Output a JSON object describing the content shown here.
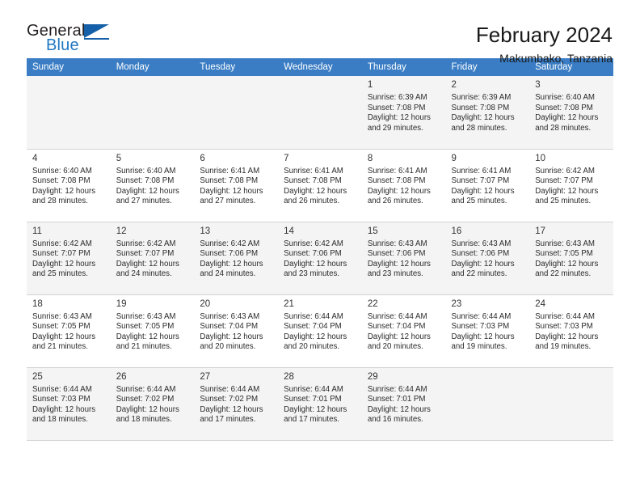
{
  "brand": {
    "name_top": "General",
    "name_bottom": "Blue",
    "flag_icon": "triangle-flag-icon",
    "color_dark": "#231f20",
    "color_blue": "#1f77c2"
  },
  "header": {
    "title": "February 2024",
    "subtitle": "Makumbako, Tanzania"
  },
  "theme": {
    "header_row_bg": "#3a7dc4",
    "header_row_text": "#ffffff",
    "alt_row_bg": "#f4f4f4",
    "grid_line": "#d3d3d3"
  },
  "weekday_headers": [
    "Sunday",
    "Monday",
    "Tuesday",
    "Wednesday",
    "Thursday",
    "Friday",
    "Saturday"
  ],
  "weeks": [
    [
      {
        "day": "",
        "info": "",
        "empty": true
      },
      {
        "day": "",
        "info": "",
        "empty": true
      },
      {
        "day": "",
        "info": "",
        "empty": true
      },
      {
        "day": "",
        "info": "",
        "empty": true
      },
      {
        "day": "1",
        "info": "Sunrise: 6:39 AM\nSunset: 7:08 PM\nDaylight: 12 hours\nand 29 minutes."
      },
      {
        "day": "2",
        "info": "Sunrise: 6:39 AM\nSunset: 7:08 PM\nDaylight: 12 hours\nand 28 minutes."
      },
      {
        "day": "3",
        "info": "Sunrise: 6:40 AM\nSunset: 7:08 PM\nDaylight: 12 hours\nand 28 minutes."
      }
    ],
    [
      {
        "day": "4",
        "info": "Sunrise: 6:40 AM\nSunset: 7:08 PM\nDaylight: 12 hours\nand 28 minutes."
      },
      {
        "day": "5",
        "info": "Sunrise: 6:40 AM\nSunset: 7:08 PM\nDaylight: 12 hours\nand 27 minutes."
      },
      {
        "day": "6",
        "info": "Sunrise: 6:41 AM\nSunset: 7:08 PM\nDaylight: 12 hours\nand 27 minutes."
      },
      {
        "day": "7",
        "info": "Sunrise: 6:41 AM\nSunset: 7:08 PM\nDaylight: 12 hours\nand 26 minutes."
      },
      {
        "day": "8",
        "info": "Sunrise: 6:41 AM\nSunset: 7:08 PM\nDaylight: 12 hours\nand 26 minutes."
      },
      {
        "day": "9",
        "info": "Sunrise: 6:41 AM\nSunset: 7:07 PM\nDaylight: 12 hours\nand 25 minutes."
      },
      {
        "day": "10",
        "info": "Sunrise: 6:42 AM\nSunset: 7:07 PM\nDaylight: 12 hours\nand 25 minutes."
      }
    ],
    [
      {
        "day": "11",
        "info": "Sunrise: 6:42 AM\nSunset: 7:07 PM\nDaylight: 12 hours\nand 25 minutes."
      },
      {
        "day": "12",
        "info": "Sunrise: 6:42 AM\nSunset: 7:07 PM\nDaylight: 12 hours\nand 24 minutes."
      },
      {
        "day": "13",
        "info": "Sunrise: 6:42 AM\nSunset: 7:06 PM\nDaylight: 12 hours\nand 24 minutes."
      },
      {
        "day": "14",
        "info": "Sunrise: 6:42 AM\nSunset: 7:06 PM\nDaylight: 12 hours\nand 23 minutes."
      },
      {
        "day": "15",
        "info": "Sunrise: 6:43 AM\nSunset: 7:06 PM\nDaylight: 12 hours\nand 23 minutes."
      },
      {
        "day": "16",
        "info": "Sunrise: 6:43 AM\nSunset: 7:06 PM\nDaylight: 12 hours\nand 22 minutes."
      },
      {
        "day": "17",
        "info": "Sunrise: 6:43 AM\nSunset: 7:05 PM\nDaylight: 12 hours\nand 22 minutes."
      }
    ],
    [
      {
        "day": "18",
        "info": "Sunrise: 6:43 AM\nSunset: 7:05 PM\nDaylight: 12 hours\nand 21 minutes."
      },
      {
        "day": "19",
        "info": "Sunrise: 6:43 AM\nSunset: 7:05 PM\nDaylight: 12 hours\nand 21 minutes."
      },
      {
        "day": "20",
        "info": "Sunrise: 6:43 AM\nSunset: 7:04 PM\nDaylight: 12 hours\nand 20 minutes."
      },
      {
        "day": "21",
        "info": "Sunrise: 6:44 AM\nSunset: 7:04 PM\nDaylight: 12 hours\nand 20 minutes."
      },
      {
        "day": "22",
        "info": "Sunrise: 6:44 AM\nSunset: 7:04 PM\nDaylight: 12 hours\nand 20 minutes."
      },
      {
        "day": "23",
        "info": "Sunrise: 6:44 AM\nSunset: 7:03 PM\nDaylight: 12 hours\nand 19 minutes."
      },
      {
        "day": "24",
        "info": "Sunrise: 6:44 AM\nSunset: 7:03 PM\nDaylight: 12 hours\nand 19 minutes."
      }
    ],
    [
      {
        "day": "25",
        "info": "Sunrise: 6:44 AM\nSunset: 7:03 PM\nDaylight: 12 hours\nand 18 minutes."
      },
      {
        "day": "26",
        "info": "Sunrise: 6:44 AM\nSunset: 7:02 PM\nDaylight: 12 hours\nand 18 minutes."
      },
      {
        "day": "27",
        "info": "Sunrise: 6:44 AM\nSunset: 7:02 PM\nDaylight: 12 hours\nand 17 minutes."
      },
      {
        "day": "28",
        "info": "Sunrise: 6:44 AM\nSunset: 7:01 PM\nDaylight: 12 hours\nand 17 minutes."
      },
      {
        "day": "29",
        "info": "Sunrise: 6:44 AM\nSunset: 7:01 PM\nDaylight: 12 hours\nand 16 minutes."
      },
      {
        "day": "",
        "info": "",
        "empty": true
      },
      {
        "day": "",
        "info": "",
        "empty": true
      }
    ]
  ]
}
